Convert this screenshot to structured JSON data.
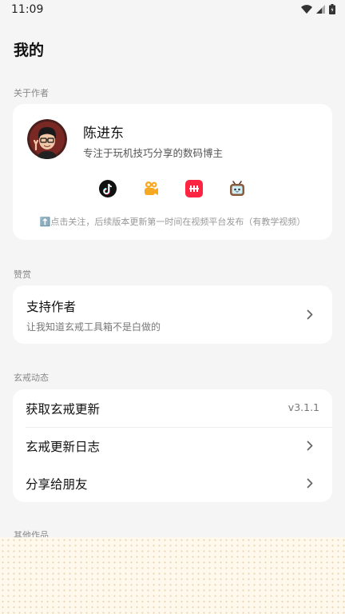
{
  "status": {
    "time": "11:09"
  },
  "page_title": "我的",
  "about": {
    "section_label": "关于作者",
    "author_name": "陈进东",
    "author_desc": "专注于玩机技巧分享的数码博主",
    "platforms": [
      "tiktok-icon",
      "kuaishou-icon",
      "xiaohongshu-icon",
      "bilibili-icon"
    ],
    "notice": "⬆️点击关注，后续版本更新第一时间在视频平台发布（有教学视频）"
  },
  "donate": {
    "section_label": "赞赏",
    "title": "支持作者",
    "subtitle": "让我知道玄戒工具箱不是白做的"
  },
  "updates": {
    "section_label": "玄戒动态",
    "items": [
      {
        "label": "获取玄戒更新",
        "value": "v3.1.1"
      },
      {
        "label": "玄戒更新日志"
      },
      {
        "label": "分享给朋友"
      }
    ]
  },
  "other": {
    "section_label": "其他作品"
  }
}
